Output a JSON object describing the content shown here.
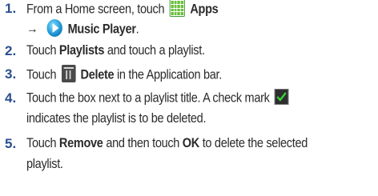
{
  "steps": [
    {
      "number": "1.",
      "line1": {
        "pre": "From a Home screen, touch",
        "icon": "apps-grid-icon",
        "bold": "Apps"
      },
      "line2": {
        "arrow": "→",
        "icon": "music-player-icon",
        "bold": "Music Player",
        "post": "."
      }
    },
    {
      "number": "2.",
      "line1": {
        "pre": "Touch ",
        "bold": "Playlists",
        "post": " and touch a playlist."
      }
    },
    {
      "number": "3.",
      "line1": {
        "pre": "Touch",
        "icon": "trash-delete-icon",
        "bold": "Delete",
        "post": " in the Application bar."
      }
    },
    {
      "number": "4.",
      "line1": {
        "pre": "Touch the box next to a playlist title. A check mark",
        "icon": "green-checkbox-icon"
      },
      "line2": {
        "pre": "indicates the playlist is to be deleted."
      }
    },
    {
      "number": "5.",
      "line1": {
        "pre": "Touch ",
        "bold": "Remove",
        "mid": " and then touch ",
        "bold2": "OK",
        "post": " to delete the selected"
      },
      "line2": {
        "pre": "playlist."
      }
    }
  ],
  "colors": {
    "number": "#2a4f8f",
    "text": "#2b2b2b",
    "check": "#3ad03a"
  }
}
